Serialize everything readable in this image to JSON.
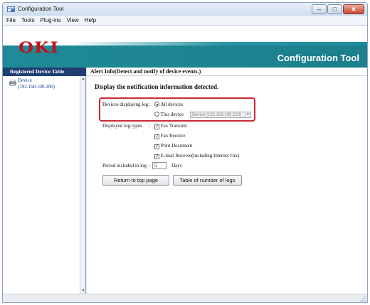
{
  "window": {
    "title": "Configuration Tool"
  },
  "menu": {
    "items": [
      "File",
      "Tools",
      "Plug-ins",
      "View",
      "Help"
    ]
  },
  "banner": {
    "logo": "OKI",
    "app_title": "Configuration Tool"
  },
  "sidebar": {
    "header": "Registered Device Table",
    "devices": [
      {
        "name": "Device",
        "ip": "(192.168.100.200)"
      }
    ]
  },
  "content": {
    "header": "Alert Info(Detect and notify of device events.)",
    "section_title": "Display the notification information detected.",
    "devices_label": "Devices displaying log :",
    "radio_all": "All devices",
    "radio_this": "This device",
    "device_select_value": "Device (192.168.100.210)",
    "log_types_label": "Displayed log types",
    "log_types_sep": ":",
    "log_types": [
      "Fax Transmit",
      "Fax Receive",
      "Print Document",
      "E-mail Receive(Including Internet Fax)"
    ],
    "period_label": "Period included in log",
    "period_sep": ":",
    "period_value": "5",
    "period_unit": "Days",
    "btn_top": "Return to top page",
    "btn_table": "Table of number of logs"
  },
  "state": {
    "selected_radio": "All devices",
    "checked_log_types": 4
  },
  "colors": {
    "accent_teal": "#1f8a98",
    "logo_red": "#c2101b",
    "highlight_red": "#cc2a36",
    "sidebar_header": "#1f3f73"
  },
  "icons": {
    "app": "app-icon",
    "minimize": "minimize-icon",
    "maximize": "maximize-icon",
    "close": "close-icon",
    "device": "printer-icon"
  }
}
